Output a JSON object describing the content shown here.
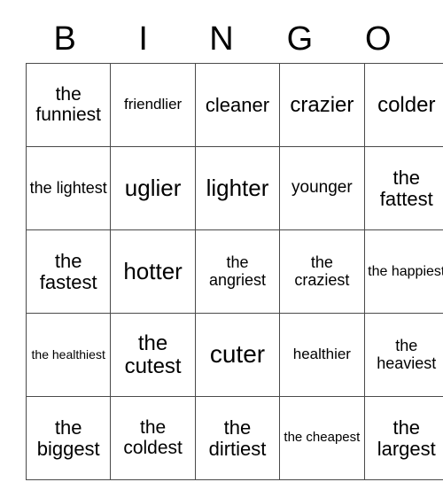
{
  "card": {
    "title_letters": [
      "B",
      "I",
      "N",
      "G",
      "O"
    ],
    "grid_line_color": "#4a4a4a",
    "text_color": "#000000",
    "background_color": "#ffffff",
    "columns": 5,
    "rows": 5,
    "cells": [
      [
        {
          "text": "the funniest",
          "size": "fs-xl"
        },
        {
          "text": "friendlier",
          "size": "fs-m"
        },
        {
          "text": "cleaner",
          "size": "fs-xxl"
        },
        {
          "text": "crazier",
          "size": "fs-3xl"
        },
        {
          "text": "colder",
          "size": "fs-3xl"
        }
      ],
      [
        {
          "text": "the lightest",
          "size": "fs-ml"
        },
        {
          "text": "uglier",
          "size": "fs-4xl"
        },
        {
          "text": "lighter",
          "size": "fs-4xl"
        },
        {
          "text": "younger",
          "size": "fs-l"
        },
        {
          "text": "the fattest",
          "size": "fs-xxl"
        }
      ],
      [
        {
          "text": "the fastest",
          "size": "fs-xxl"
        },
        {
          "text": "hotter",
          "size": "fs-4xl"
        },
        {
          "text": "the angriest",
          "size": "fs-ml"
        },
        {
          "text": "the craziest",
          "size": "fs-ml"
        },
        {
          "text": "the happiest",
          "size": "fs-sm"
        }
      ],
      [
        {
          "text": "the healthiest",
          "size": "fs-xs"
        },
        {
          "text": "the cutest",
          "size": "fs-3xl"
        },
        {
          "text": "cuter",
          "size": "fs-5xl"
        },
        {
          "text": "healthier",
          "size": "fs-m"
        },
        {
          "text": "the heaviest",
          "size": "fs-ml"
        }
      ],
      [
        {
          "text": "the biggest",
          "size": "fs-xxl"
        },
        {
          "text": "the coldest",
          "size": "fs-xl"
        },
        {
          "text": "the dirtiest",
          "size": "fs-xxl"
        },
        {
          "text": "the cheapest",
          "size": "fs-s"
        },
        {
          "text": "the largest",
          "size": "fs-xxl"
        }
      ]
    ]
  }
}
